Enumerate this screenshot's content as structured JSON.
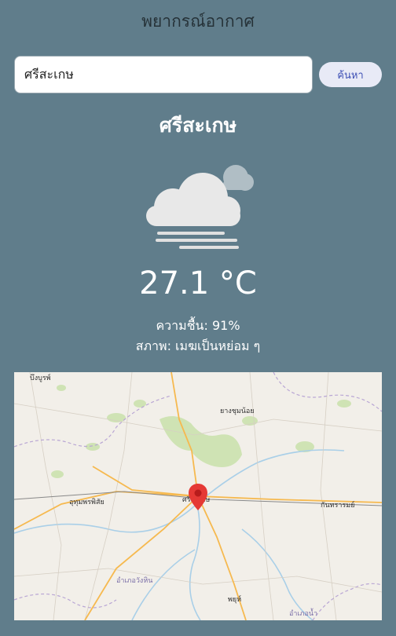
{
  "header": {
    "title": "พยากรณ์อากาศ"
  },
  "search": {
    "value": "ศรีสะเกษ",
    "button_label": "ค้นหา"
  },
  "weather": {
    "city": "ศรีสะเกษ",
    "temperature": "27.1 °C",
    "humidity": "ความชื้น: 91%",
    "condition": "สภาพ: เมฆเป็นหย่อม ๆ",
    "icon": "fog-cloud-icon"
  },
  "map": {
    "labels": {
      "l1": "บึงบูรพ์",
      "l2": "ยางชุมน้อย",
      "l3": "อุทุมพรพิสัย",
      "l4": "ศรีสะเกษ",
      "l5": "กันทรารมย์",
      "l6": "อำเภอวังหิน",
      "l7": "พยุห์",
      "l8": "อำเภอน้ำ"
    },
    "pin_color": "#e53935"
  }
}
